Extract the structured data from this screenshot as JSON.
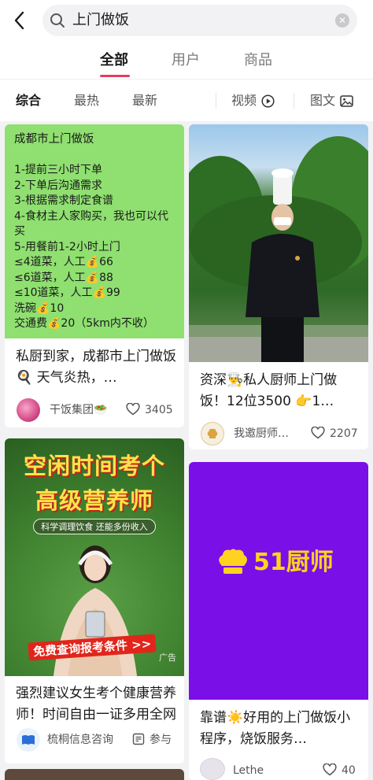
{
  "search": {
    "query": "上门做饭"
  },
  "tabs": [
    {
      "label": "全部"
    },
    {
      "label": "用户"
    },
    {
      "label": "商品"
    }
  ],
  "filters": {
    "sort": [
      "综合",
      "最热",
      "最新"
    ],
    "video_label": "视频",
    "image_label": "图文"
  },
  "feed": {
    "card1": {
      "image_text": [
        "成都市上门做饭",
        "",
        "1-提前三小时下单",
        "2-下单后沟通需求",
        "3-根据需求制定食谱",
        "4-食材主人家购买，我也可以代",
        "买",
        "5-用餐前1-2小时上门",
        "≤4道菜，人工💰66",
        "≤6道菜，人工💰88",
        "≤10道菜，人工💰99",
        "洗碗💰10",
        "交通费💰20（5km内不收）"
      ],
      "title": "私厨到家，成都市上门做饭🍳 天气炎热，…",
      "author": "干饭集团🥗",
      "likes": "3405"
    },
    "card2": {
      "title": "资深👨‍🍳私人厨师上门做饭！12位3500 👉1…",
      "author": "我邀厨师…",
      "likes": "2207"
    },
    "card3": {
      "banner_line1": "空闲时间考个",
      "banner_line2": "高级营养师",
      "banner_sub": "科学调理饮食 还能多份收入",
      "banner_cta": "免费查询报考条件 >>",
      "ad_label": "广告",
      "title": "强烈建议女生考个健康营养师！时间自由一证多用全网",
      "author": "梳桐信息咨询",
      "action": "参与"
    },
    "card4": {
      "logo_text": "51厨师",
      "title": "靠谱☀️好用的上门做饭小程序，烧饭服务…",
      "author": "Lethe",
      "likes": "40"
    }
  },
  "colors": {
    "accent": "#e83b5c",
    "card1_bg": "#8fe070",
    "card4_bg": "#7a0fe8",
    "logo_yellow": "#ffd21f"
  }
}
